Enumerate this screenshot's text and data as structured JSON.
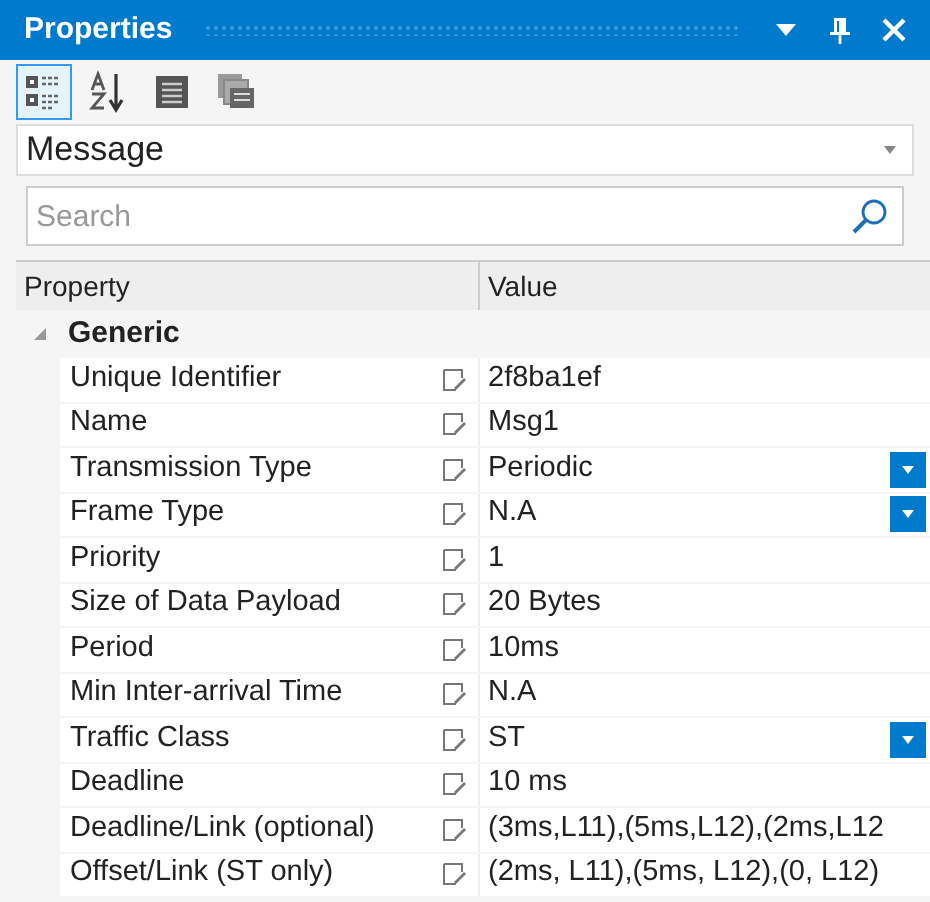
{
  "window": {
    "title": "Properties"
  },
  "title_buttons": [
    {
      "kind": "dropdown"
    },
    {
      "kind": "pin"
    },
    {
      "kind": "close"
    }
  ],
  "toolbar": [
    {
      "kind": "categorized",
      "selected": true
    },
    {
      "kind": "alphabetical",
      "selected": false
    },
    {
      "kind": "properties",
      "selected": false
    },
    {
      "kind": "pages",
      "selected": false
    }
  ],
  "object_selector": {
    "value": "Message"
  },
  "search": {
    "placeholder": "Search"
  },
  "columns": [
    "Property",
    "Value"
  ],
  "category": {
    "label": "Generic",
    "expanded": true,
    "rows": [
      {
        "name": "Unique Identifier",
        "value": "2f8ba1ef",
        "kind": "text"
      },
      {
        "name": "Name",
        "value": "Msg1",
        "kind": "text"
      },
      {
        "name": "Transmission Type",
        "value": "Periodic",
        "kind": "dropdown"
      },
      {
        "name": "Frame Type",
        "value": "N.A",
        "kind": "dropdown"
      },
      {
        "name": "Priority",
        "value": "1",
        "kind": "text"
      },
      {
        "name": "Size of Data Payload",
        "value": "20 Bytes",
        "kind": "text"
      },
      {
        "name": "Period",
        "value": "10ms",
        "kind": "text"
      },
      {
        "name": "Min Inter-arrival Time",
        "value": "N.A",
        "kind": "text"
      },
      {
        "name": "Traffic Class",
        "value": "ST",
        "kind": "dropdown"
      },
      {
        "name": "Deadline",
        "value": "10 ms",
        "kind": "text"
      },
      {
        "name": "Deadline/Link (optional)",
        "value": "(3ms,L11),(5ms,L12),(2ms,L12",
        "kind": "text"
      },
      {
        "name": "Offset/Link (ST only)",
        "value": "(2ms, L11),(5ms, L12),(0, L12)",
        "kind": "text"
      }
    ]
  }
}
